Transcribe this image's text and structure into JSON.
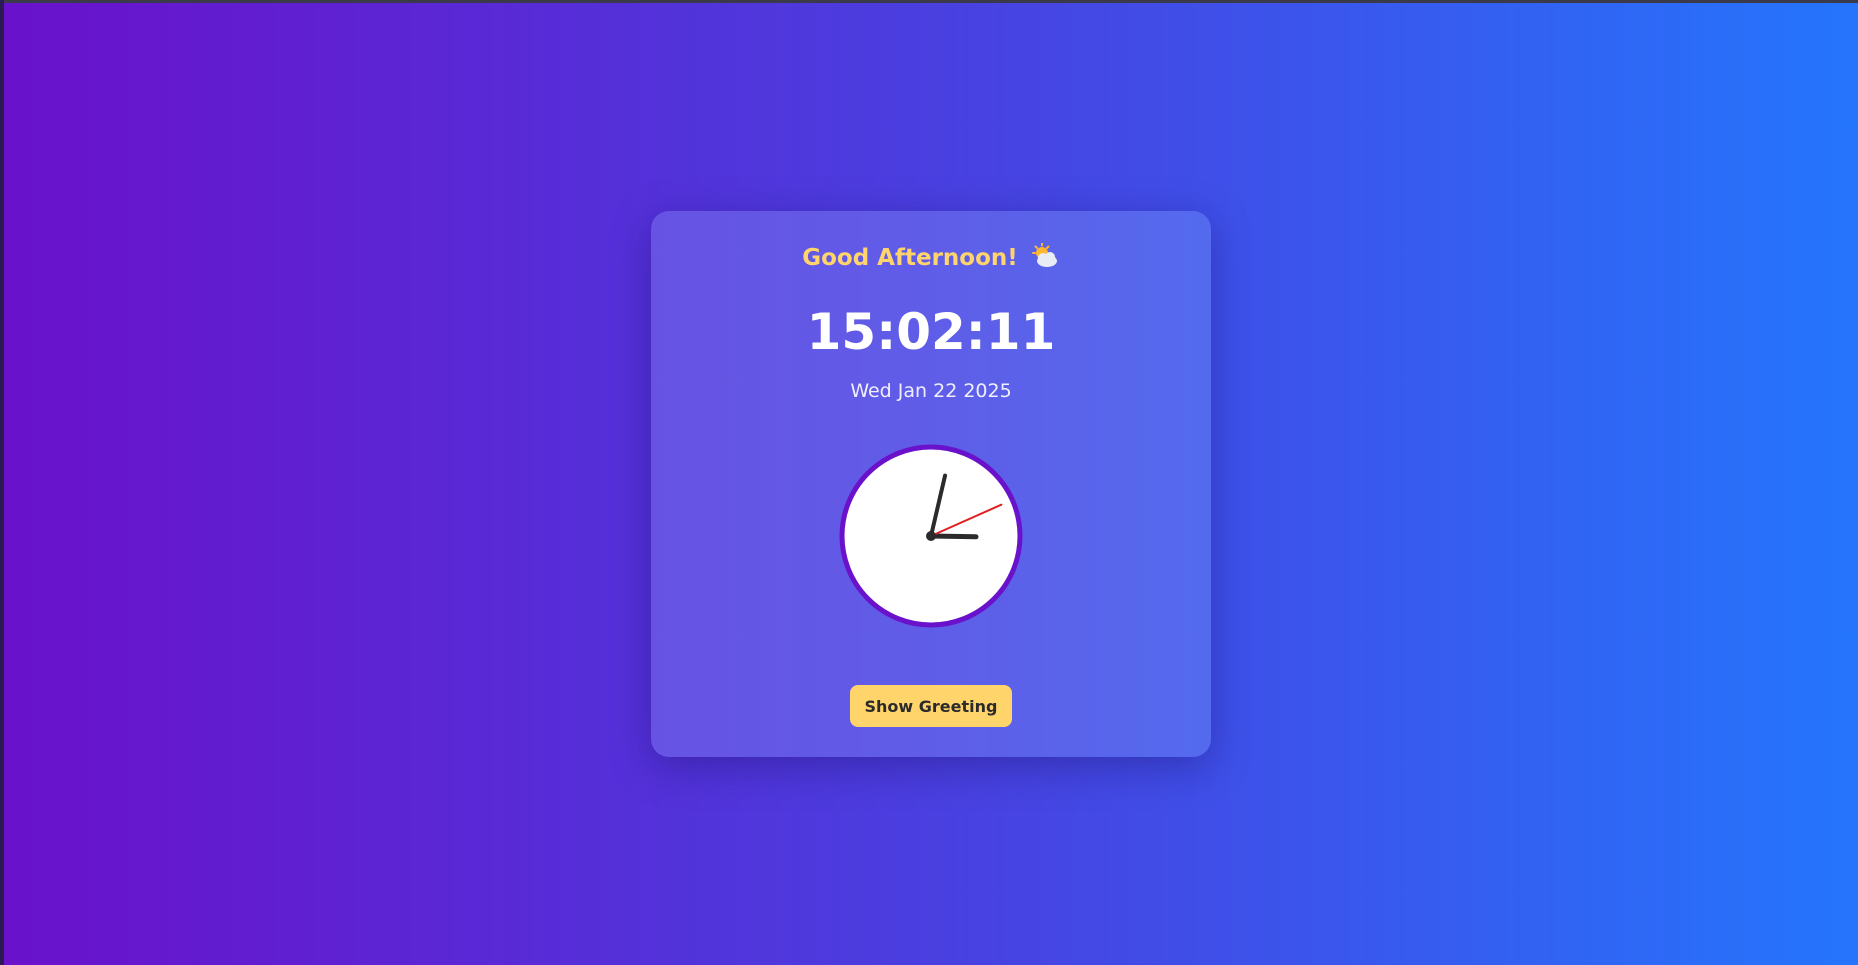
{
  "greeting": {
    "text": "Good Afternoon!",
    "icon": "sun-behind-cloud-icon"
  },
  "clock": {
    "digital_time": "15:02:11",
    "date": "Wed Jan 22 2025",
    "hours": 15,
    "minutes": 2,
    "seconds": 11
  },
  "button": {
    "label": "Show Greeting"
  },
  "colors": {
    "accent": "#ffd56b",
    "gradient_start": "#6a11cb",
    "gradient_end": "#2575fc",
    "clock_border": "#6a11cb",
    "second_hand": "#e02020",
    "hands": "#2b2b2b"
  }
}
